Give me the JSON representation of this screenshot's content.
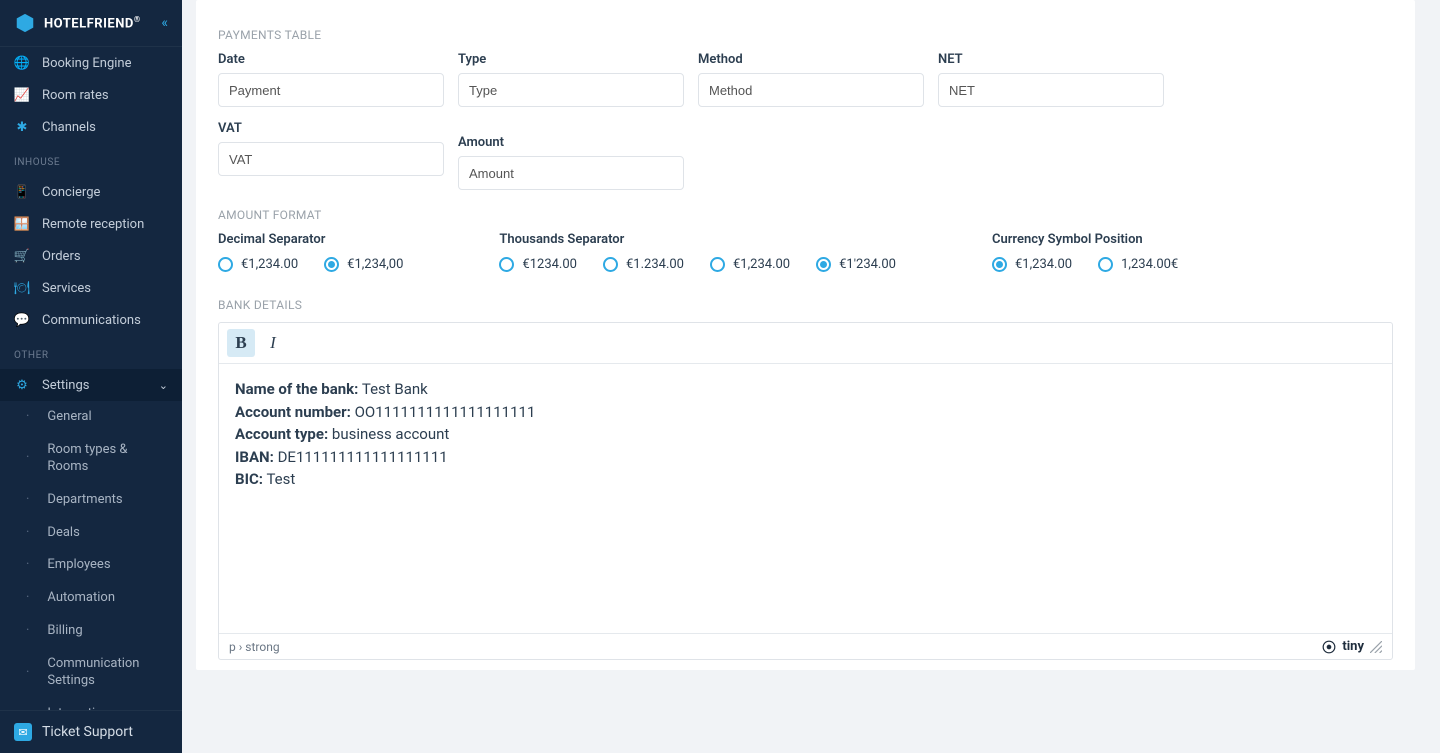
{
  "brand": {
    "name": "HOTELFRIEND",
    "trademark": "®"
  },
  "sidebar": {
    "main_items": [
      {
        "label": "Booking Engine",
        "icon": "globe-icon"
      },
      {
        "label": "Room rates",
        "icon": "line-chart-icon"
      },
      {
        "label": "Channels",
        "icon": "share-icon"
      }
    ],
    "groups": [
      {
        "title": "INHOUSE",
        "items": [
          {
            "label": "Concierge",
            "icon": "mobile-icon"
          },
          {
            "label": "Remote reception",
            "icon": "reception-icon"
          },
          {
            "label": "Orders",
            "icon": "cart-icon"
          },
          {
            "label": "Services",
            "icon": "cloche-icon"
          },
          {
            "label": "Communications",
            "icon": "chat-icon"
          }
        ]
      },
      {
        "title": "OTHER",
        "items": [
          {
            "label": "Settings",
            "icon": "gear-icon",
            "expanded": true,
            "children": [
              "General",
              "Room types & Rooms",
              "Departments",
              "Deals",
              "Employees",
              "Automation",
              "Billing",
              "Communication Settings",
              "Integrations"
            ]
          }
        ]
      }
    ],
    "ticket_support": "Ticket Support"
  },
  "sections": {
    "payments_table": {
      "title": "PAYMENTS TABLE",
      "fields": [
        {
          "label": "Date",
          "value": "Payment"
        },
        {
          "label": "Type",
          "value": "Type"
        },
        {
          "label": "Method",
          "value": "Method"
        },
        {
          "label": "NET",
          "value": "NET"
        },
        {
          "label": "VAT",
          "value": "VAT"
        },
        {
          "label": "Amount",
          "value": "Amount"
        }
      ]
    },
    "amount_format": {
      "title": "AMOUNT FORMAT",
      "decimal_label": "Decimal Separator",
      "decimal_options": [
        {
          "label": "€1,234.00",
          "checked": false
        },
        {
          "label": "€1,234,00",
          "checked": true
        }
      ],
      "thousands_label": "Thousands Separator",
      "thousands_options": [
        {
          "label": "€1234.00",
          "checked": false
        },
        {
          "label": "€1.234.00",
          "checked": false
        },
        {
          "label": "€1,234.00",
          "checked": false
        },
        {
          "label": "€1'234.00",
          "checked": true
        }
      ],
      "currency_pos_label": "Currency Symbol Position",
      "currency_pos_options": [
        {
          "label": "€1,234.00",
          "checked": true
        },
        {
          "label": "1,234.00€",
          "checked": false
        }
      ]
    },
    "bank_details": {
      "title": "BANK DETAILS",
      "editor_path": "p › strong",
      "tiny_brand": "tiny",
      "lines": [
        {
          "k": "Name of the bank:",
          "v": " Test Bank"
        },
        {
          "k": "Account number:",
          "v": " OO1111111111111111111"
        },
        {
          "k": "Account type:",
          "v": " business account"
        },
        {
          "k": "IBAN:",
          "v": " DE111111111111111111"
        },
        {
          "k": "BIC:",
          "v": " Test"
        }
      ]
    }
  }
}
